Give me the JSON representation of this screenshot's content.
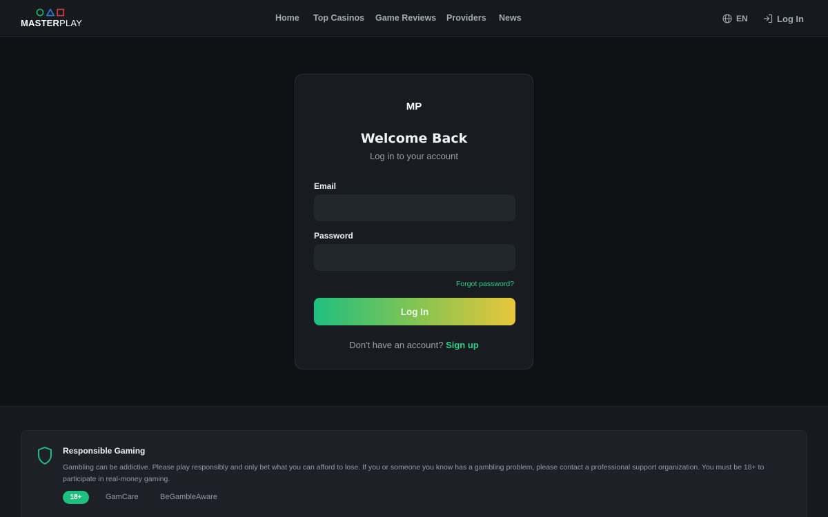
{
  "header": {
    "logo": {
      "bold": "MASTER",
      "light": "PLAY"
    },
    "nav": [
      "Home",
      "Top Casinos",
      "Game Reviews",
      "Providers",
      "News"
    ],
    "language": "EN",
    "login_label": "Log In"
  },
  "card": {
    "logo_text": "MP",
    "title": "Welcome Back",
    "subtitle": "Log in to your account",
    "email_label": "Email",
    "email_value": "",
    "password_label": "Password",
    "password_value": "",
    "forgot_label": "Forgot password?",
    "submit_label": "Log In",
    "signup_prompt": "Don't have an account?",
    "signup_link": "Sign up"
  },
  "footer": {
    "title": "Responsible Gaming",
    "text": "Gambling can be addictive. Please play responsibly and only bet what you can afford to lose. If you or someone you know has a gambling problem, please contact a professional support organization. You must be 18+ to participate in real-money gaming.",
    "age_badge": "18+",
    "links": [
      "GamCare",
      "BeGambleAware"
    ]
  },
  "colors": {
    "accent_green": "#2ecf8b",
    "accent_yellow": "#e8c63a",
    "background": "#0f1114",
    "card": "#181b20"
  },
  "icons": [
    "circle-logo-icon",
    "triangle-logo-icon",
    "square-logo-icon",
    "globe-icon",
    "login-arrow-icon",
    "shield-icon"
  ]
}
